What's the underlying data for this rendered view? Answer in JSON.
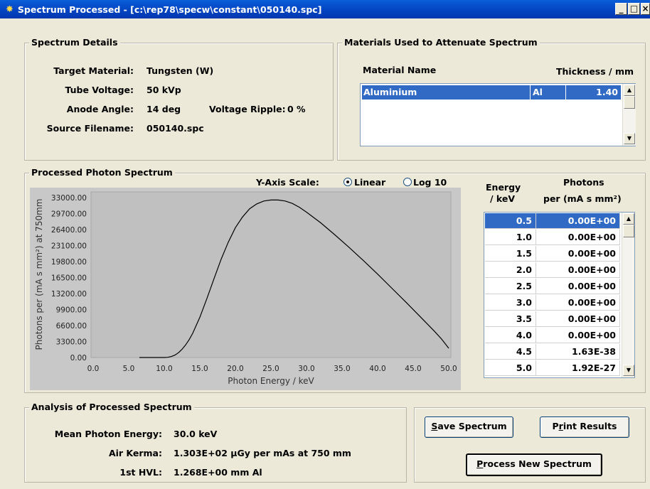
{
  "window": {
    "title": "Spectrum Processed - [c:\\rep78\\specw\\constant\\050140.spc]"
  },
  "details": {
    "title": "Spectrum Details",
    "target_label": "Target Material:",
    "target_value": "Tungsten (W)",
    "voltage_label": "Tube Voltage:",
    "voltage_value": "50 kVp",
    "angle_label": "Anode Angle:",
    "angle_value": "14 deg",
    "ripple_label": "Voltage Ripple:",
    "ripple_value": "0 %",
    "file_label": "Source Filename:",
    "file_value": "050140.spc"
  },
  "materials": {
    "title": "Materials Used to Attenuate Spectrum",
    "col_name": "Material Name",
    "col_thickness": "Thickness / mm",
    "rows": [
      {
        "name": "Aluminium",
        "symbol": "Al",
        "thickness": "1.40"
      }
    ]
  },
  "spectrum": {
    "title": "Processed Photon Spectrum",
    "scale_label": "Y-Axis Scale:",
    "scale_linear": "Linear",
    "scale_log": "Log 10",
    "selected_scale": "Linear"
  },
  "chart_data": {
    "type": "line",
    "xlabel": "Photon Energy / keV",
    "ylabel": "Photons per (mA s mm²) at 750mm",
    "xlim": [
      0,
      50
    ],
    "ylim": [
      0,
      33000
    ],
    "x_ticks": [
      "0.0",
      "5.0",
      "10.0",
      "15.0",
      "20.0",
      "25.0",
      "30.0",
      "35.0",
      "40.0",
      "45.0",
      "50.0"
    ],
    "y_ticks": [
      "33000.00",
      "29700.00",
      "26400.00",
      "23100.00",
      "19800.00",
      "16500.00",
      "13200.00",
      "9900.00",
      "6600.00",
      "3300.00",
      "0.00"
    ],
    "series": [
      {
        "x": [
          6.5,
          8,
          9,
          10,
          10.5,
          11,
          11.5,
          12,
          12.5,
          13,
          13.5,
          14,
          15,
          16,
          17,
          18,
          19,
          20,
          21,
          22,
          23,
          24,
          25,
          26,
          27,
          28,
          29,
          30,
          32,
          34,
          36,
          38,
          40,
          42,
          44,
          46,
          48,
          49,
          50
        ],
        "values": [
          0,
          0,
          0,
          0,
          50,
          200,
          500,
          1000,
          1700,
          2600,
          3700,
          5000,
          8300,
          12200,
          16300,
          20300,
          23800,
          26800,
          29000,
          30700,
          31700,
          32300,
          32500,
          32500,
          32300,
          31800,
          31000,
          30000,
          27800,
          25300,
          22700,
          20000,
          17200,
          14300,
          11400,
          8400,
          5400,
          3800,
          1900
        ]
      }
    ]
  },
  "energy_table": {
    "col_energy_1": "Energy",
    "col_energy_2": "/ keV",
    "col_photons_1": "Photons",
    "col_photons_2": "per (mA s mm²)",
    "rows": [
      {
        "energy": "0.5",
        "photons": "0.00E+00"
      },
      {
        "energy": "1.0",
        "photons": "0.00E+00"
      },
      {
        "energy": "1.5",
        "photons": "0.00E+00"
      },
      {
        "energy": "2.0",
        "photons": "0.00E+00"
      },
      {
        "energy": "2.5",
        "photons": "0.00E+00"
      },
      {
        "energy": "3.0",
        "photons": "0.00E+00"
      },
      {
        "energy": "3.5",
        "photons": "0.00E+00"
      },
      {
        "energy": "4.0",
        "photons": "0.00E+00"
      },
      {
        "energy": "4.5",
        "photons": "1.63E-38"
      },
      {
        "energy": "5.0",
        "photons": "1.92E-27"
      }
    ]
  },
  "analysis": {
    "title": "Analysis of Processed Spectrum",
    "mean_label": "Mean Photon Energy:",
    "mean_value": "30.0 keV",
    "kerma_label": "Air Kerma:",
    "kerma_value": "1.303E+02 μGy per mAs at 750 mm",
    "hvl_label": "1st HVL:",
    "hvl_value": "1.268E+00 mm Al"
  },
  "buttons": {
    "save_acc": "S",
    "save_rest": "ave Spectrum",
    "print_pre": "P",
    "print_acc": "r",
    "print_rest": "int Results",
    "process_acc": "P",
    "process_rest": "rocess New Spectrum"
  }
}
